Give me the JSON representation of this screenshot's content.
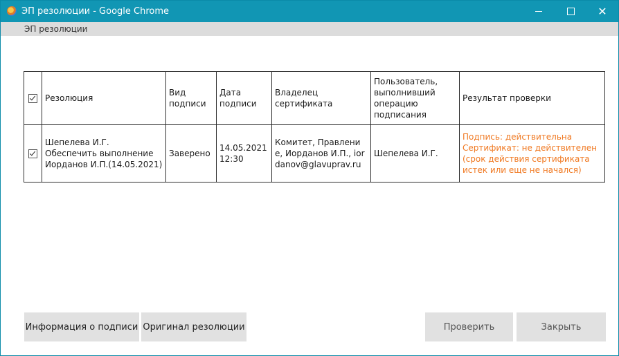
{
  "window": {
    "title": "ЭП резолюции - Google Chrome",
    "minimize_icon": "minimize-icon",
    "maximize_icon": "maximize-icon",
    "close_glyph": "✕",
    "titlebar_color": "#1196b4"
  },
  "tab": {
    "label": "ЭП резолюции"
  },
  "table": {
    "headers": {
      "resolution": "Резолюция",
      "sign_type": "Вид подписи",
      "sign_date": "Дата подписи",
      "cert_owner": "Владелец сертификата",
      "user": "Пользователь, выполнивший операцию подписания",
      "result": "Результат проверки"
    },
    "header_checked": true,
    "rows": [
      {
        "checked": true,
        "resolution_line1": "Шепелева И.Г.",
        "resolution_line2": "Обеспечить выполнение",
        "resolution_line3": "Иорданов И.П.(14.05.2021)",
        "sign_type": "Заверено",
        "sign_date_line1": "14.05.2021",
        "sign_date_line2": "12:30",
        "cert_owner": "Комитет, Правление, Иорданов И.П., iordanov@glavuprav.ru",
        "user": "Шепелева И.Г.",
        "result_line1": "Подпись: действительна",
        "result_line2": "Сертификат: не действителен (срок действия сертификата истек или еще не начался)",
        "result_color": "#f07820"
      }
    ]
  },
  "buttons": {
    "info": "Информация о подписи",
    "original": "Оригинал резолюции",
    "check": "Проверить",
    "close": "Закрыть"
  }
}
